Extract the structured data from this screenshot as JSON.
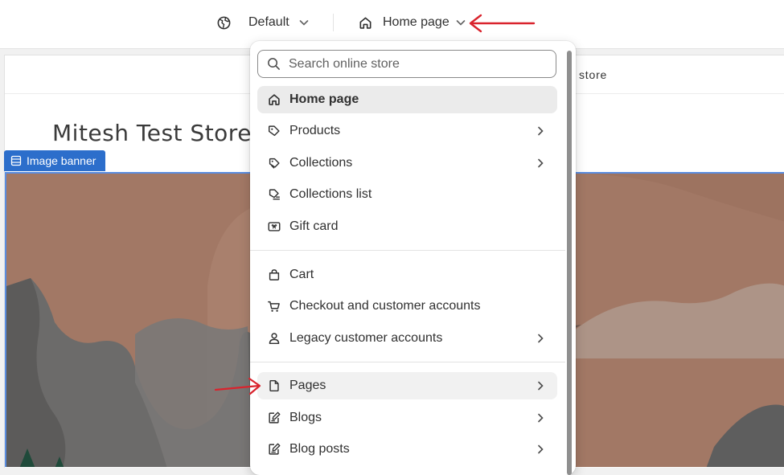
{
  "topbar": {
    "theme_selector_label": "Default",
    "template_selector_label": "Home page"
  },
  "preview": {
    "announcement_text": "store",
    "store_name": "Mitesh Test Store",
    "section_tag_label": "Image banner"
  },
  "dropdown": {
    "search_placeholder": "Search online store",
    "items": [
      {
        "label": "Home page",
        "icon": "home-icon",
        "has_submenu": false
      },
      {
        "label": "Products",
        "icon": "tag-icon",
        "has_submenu": true
      },
      {
        "label": "Collections",
        "icon": "collection-icon",
        "has_submenu": true
      },
      {
        "label": "Collections list",
        "icon": "collection-list-icon",
        "has_submenu": false
      },
      {
        "label": "Gift card",
        "icon": "gift-card-icon",
        "has_submenu": false
      },
      {
        "label": "Cart",
        "icon": "bag-icon",
        "has_submenu": false
      },
      {
        "label": "Checkout and customer accounts",
        "icon": "cart-icon",
        "has_submenu": false
      },
      {
        "label": "Legacy customer accounts",
        "icon": "person-icon",
        "has_submenu": true
      },
      {
        "label": "Pages",
        "icon": "page-icon",
        "has_submenu": true
      },
      {
        "label": "Blogs",
        "icon": "blog-icon",
        "has_submenu": true
      },
      {
        "label": "Blog posts",
        "icon": "blog-post-icon",
        "has_submenu": true
      }
    ]
  },
  "colors": {
    "accent_blue": "#2c6ecb",
    "annotation_red": "#d9232d",
    "banner_base": "#a27865"
  }
}
